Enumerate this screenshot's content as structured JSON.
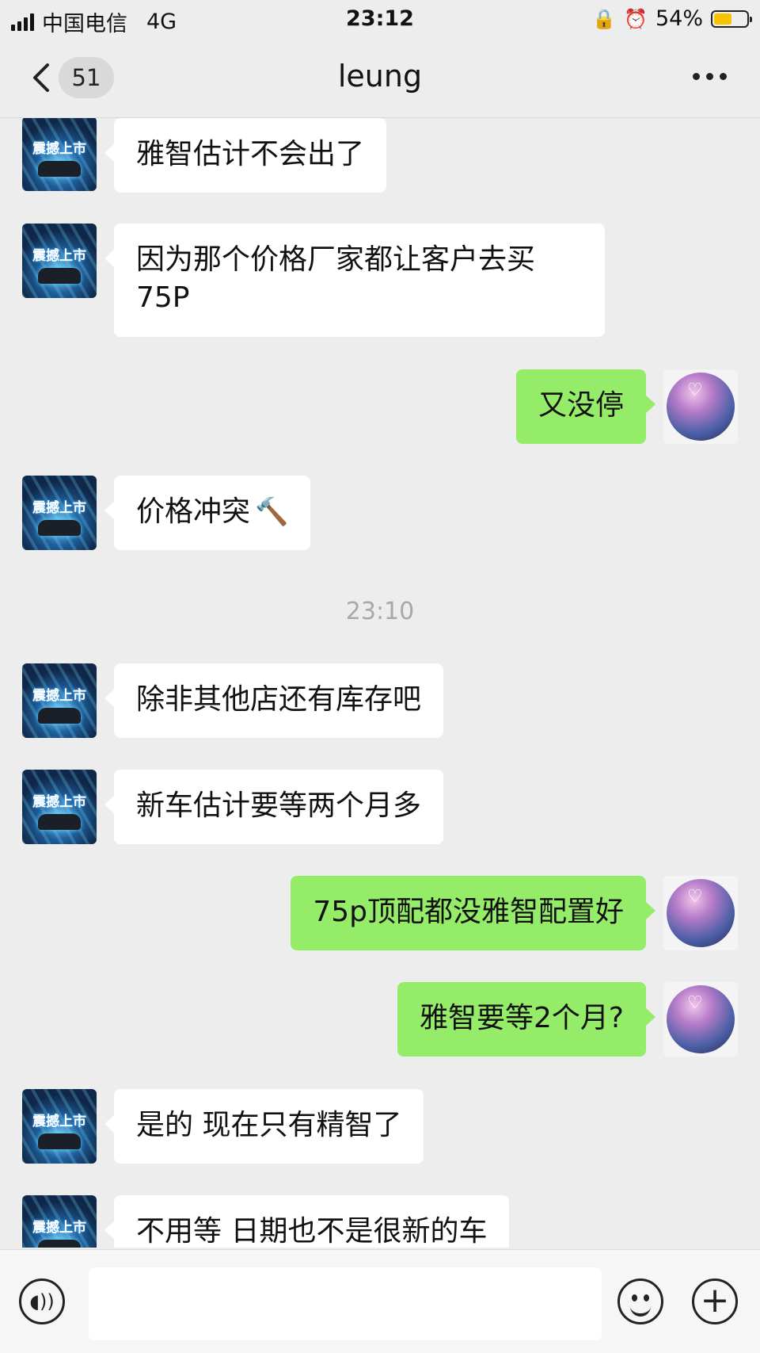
{
  "status_bar": {
    "carrier": "中国电信",
    "network": "4G",
    "time": "23:12",
    "battery_percent": "54%",
    "battery_level": 0.54
  },
  "nav": {
    "back_icon": "chevron-left-icon",
    "unread_count": "51",
    "title": "leung",
    "more_icon": "more-icon"
  },
  "messages": [
    {
      "from": "contact",
      "text": "雅智估计不会出了"
    },
    {
      "from": "contact",
      "text": "因为那个价格厂家都让客户去买",
      "text2": "75P"
    },
    {
      "from": "me",
      "text": "又没停"
    },
    {
      "from": "contact",
      "text": "价格冲突",
      "emoji": "hammer-emoji"
    },
    {
      "type": "time",
      "text": "23:10"
    },
    {
      "from": "contact",
      "text": "除非其他店还有库存吧"
    },
    {
      "from": "contact",
      "text": "新车估计要等两个月多"
    },
    {
      "from": "me",
      "text": "75p顶配都没雅智配置好"
    },
    {
      "from": "me",
      "text": "雅智要等2个月?"
    },
    {
      "from": "contact",
      "text": "是的 现在只有精智了"
    },
    {
      "from": "contact",
      "text": "不用等 日期也不是很新的车"
    }
  ],
  "contact_avatar": {
    "caption": "震撼上市"
  },
  "input_bar": {
    "voice_icon": "voice-icon",
    "emoji_icon": "emoji-icon",
    "add_icon": "plus-circle-icon",
    "placeholder": ""
  },
  "colors": {
    "background": "#ededed",
    "outgoing_bubble": "#95ec69",
    "incoming_bubble": "#ffffff",
    "battery_fill": "#f6c400"
  }
}
